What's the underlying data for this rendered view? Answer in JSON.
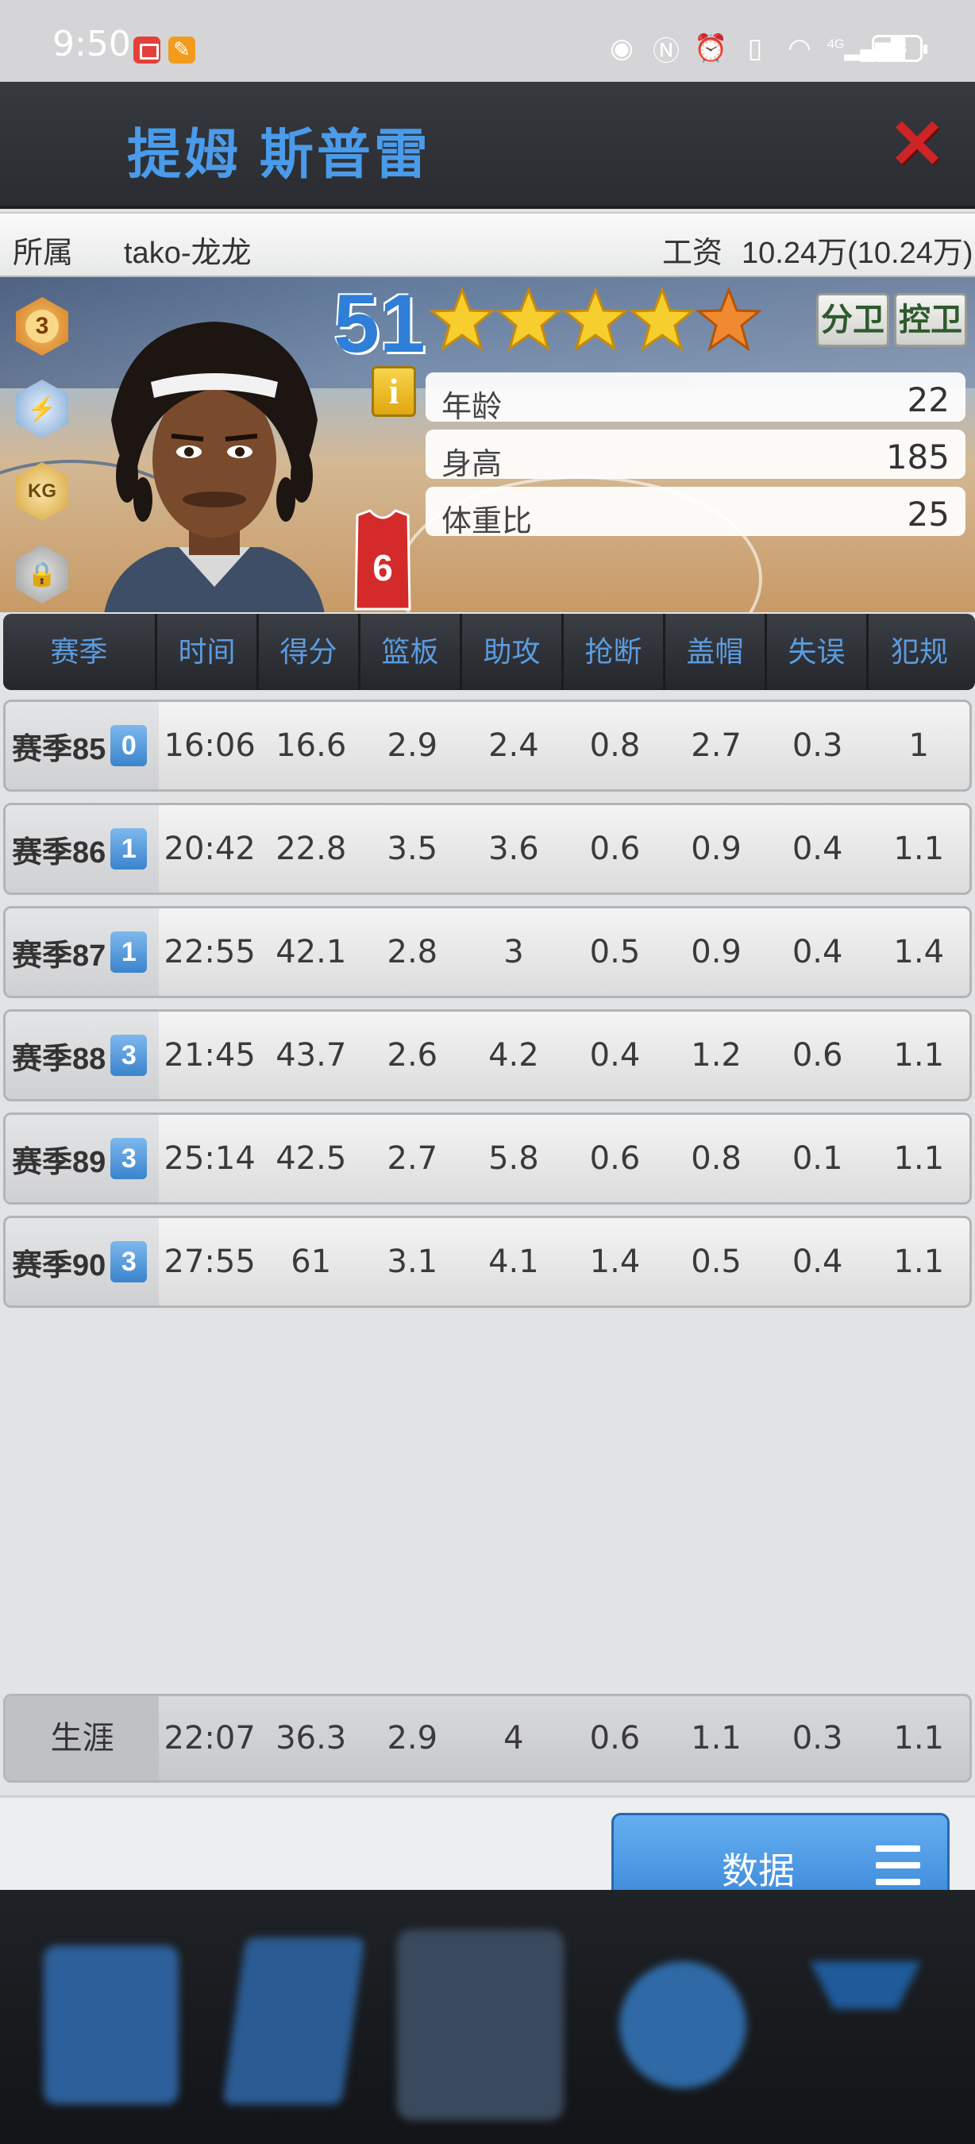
{
  "status_bar": {
    "time": "9:50",
    "battery": "63",
    "network": "4G"
  },
  "dialog": {
    "player_name": "提姆 斯普雷",
    "close_icon": "close-icon",
    "team_label": "所属",
    "team_value": "tako-龙龙",
    "salary_label": "工资",
    "salary_value": "10.24万(10.24万)"
  },
  "card": {
    "rating": "51",
    "stars": 4.5,
    "positions": [
      "分卫",
      "控卫"
    ],
    "jersey_number": "6",
    "badge_level": "3",
    "kg_label": "KG",
    "info_icon": "i",
    "attributes": [
      {
        "key": "年龄",
        "value": "22"
      },
      {
        "key": "身高",
        "value": "185"
      },
      {
        "key": "体重比",
        "value": "25"
      }
    ]
  },
  "table": {
    "headers": [
      "赛季",
      "时间",
      "得分",
      "篮板",
      "助攻",
      "抢断",
      "盖帽",
      "失误",
      "犯规"
    ],
    "rows": [
      {
        "season": "赛季85",
        "tier": "0",
        "cells": [
          "16:06",
          "16.6",
          "2.9",
          "2.4",
          "0.8",
          "2.7",
          "0.3",
          "1"
        ]
      },
      {
        "season": "赛季86",
        "tier": "1",
        "cells": [
          "20:42",
          "22.8",
          "3.5",
          "3.6",
          "0.6",
          "0.9",
          "0.4",
          "1.1"
        ]
      },
      {
        "season": "赛季87",
        "tier": "1",
        "cells": [
          "22:55",
          "42.1",
          "2.8",
          "3",
          "0.5",
          "0.9",
          "0.4",
          "1.4"
        ]
      },
      {
        "season": "赛季88",
        "tier": "3",
        "cells": [
          "21:45",
          "43.7",
          "2.6",
          "4.2",
          "0.4",
          "1.2",
          "0.6",
          "1.1"
        ]
      },
      {
        "season": "赛季89",
        "tier": "3",
        "cells": [
          "25:14",
          "42.5",
          "2.7",
          "5.8",
          "0.6",
          "0.8",
          "0.1",
          "1.1"
        ]
      },
      {
        "season": "赛季90",
        "tier": "3",
        "cells": [
          "27:55",
          "61",
          "3.1",
          "4.1",
          "1.4",
          "0.5",
          "0.4",
          "1.1"
        ]
      }
    ],
    "career": {
      "label": "生涯",
      "cells": [
        "22:07",
        "36.3",
        "2.9",
        "4",
        "0.6",
        "1.1",
        "0.3",
        "1.1"
      ]
    }
  },
  "footer": {
    "data_button_label": "数据",
    "menu_icon": "hamburger-menu-icon"
  },
  "colors": {
    "accent_blue": "#4a9be9",
    "header_dark": "#2a2c31",
    "close_red": "#cf2427",
    "button_blue": "#3a86d8"
  }
}
